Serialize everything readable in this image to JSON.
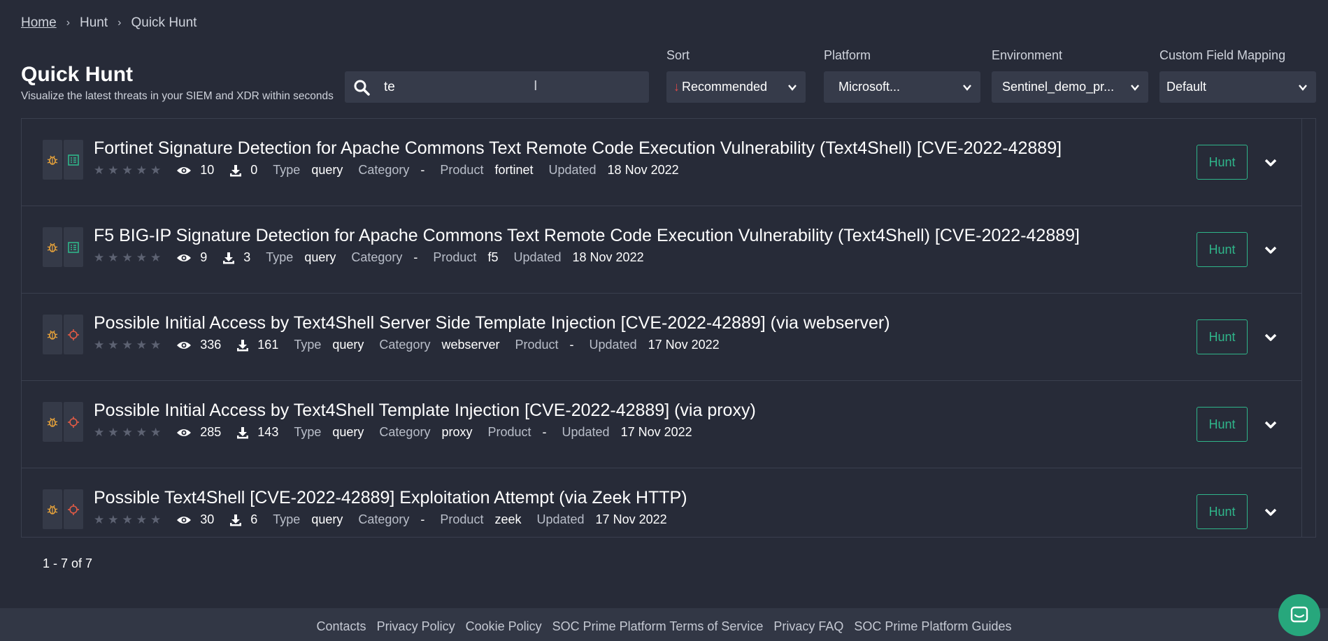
{
  "breadcrumb": {
    "home": "Home",
    "hunt": "Hunt",
    "current": "Quick Hunt"
  },
  "header": {
    "title": "Quick Hunt",
    "subtitle": "Visualize the latest threats in your SIEM and XDR within seconds"
  },
  "search": {
    "value": "te",
    "icon": "search-icon"
  },
  "filters": {
    "sort": {
      "label": "Sort",
      "value": "Recommended",
      "direction_icon": "arrow-down-icon"
    },
    "platform": {
      "label": "Platform",
      "value": "Microsoft..."
    },
    "environment": {
      "label": "Environment",
      "value": "Sentinel_demo_pr..."
    },
    "custom_field_mapping": {
      "label": "Custom Field Mapping",
      "value": "Default"
    }
  },
  "labels": {
    "type": "Type",
    "category": "Category",
    "product": "Product",
    "updated": "Updated",
    "hunt": "Hunt"
  },
  "results": [
    {
      "title": "Fortinet Signature Detection for Apache Commons Text Remote Code Execution Vulnerability (Text4Shell) [CVE-2022-42889]",
      "rating": 0,
      "views": "10",
      "downloads": "0",
      "type": "query",
      "category": "-",
      "product": "fortinet",
      "updated": "18 Nov 2022",
      "kind": "signature"
    },
    {
      "title": "F5 BIG-IP Signature Detection for Apache Commons Text Remote Code Execution Vulnerability (Text4Shell) [CVE-2022-42889]",
      "rating": 0,
      "views": "9",
      "downloads": "3",
      "type": "query",
      "category": "-",
      "product": "f5",
      "updated": "18 Nov 2022",
      "kind": "signature"
    },
    {
      "title": "Possible Initial Access by Text4Shell Server Side Template Injection [CVE-2022-42889] (via webserver)",
      "rating": 0,
      "views": "336",
      "downloads": "161",
      "type": "query",
      "category": "webserver",
      "product": "-",
      "updated": "17 Nov 2022",
      "kind": "target"
    },
    {
      "title": "Possible Initial Access by Text4Shell Template Injection [CVE-2022-42889] (via proxy)",
      "rating": 0,
      "views": "285",
      "downloads": "143",
      "type": "query",
      "category": "proxy",
      "product": "-",
      "updated": "17 Nov 2022",
      "kind": "target"
    },
    {
      "title": "Possible Text4Shell [CVE-2022-42889] Exploitation Attempt (via Zeek HTTP)",
      "rating": 0,
      "views": "30",
      "downloads": "6",
      "type": "query",
      "category": "-",
      "product": "zeek",
      "updated": "17 Nov 2022",
      "kind": "target"
    }
  ],
  "pagination": {
    "text": "1 - 7 of 7"
  },
  "footer": {
    "links": [
      "Contacts",
      "Privacy Policy",
      "Cookie Policy",
      "SOC Prime Platform Terms of Service",
      "Privacy FAQ",
      "SOC Prime Platform Guides"
    ]
  },
  "colors": {
    "background": "#272b38",
    "accent": "#2fb58a",
    "bug_icon": "#e8a33a",
    "target_icon": "#e05a45",
    "list_icon": "#2fb58a",
    "sort_arrow": "#e04848"
  }
}
